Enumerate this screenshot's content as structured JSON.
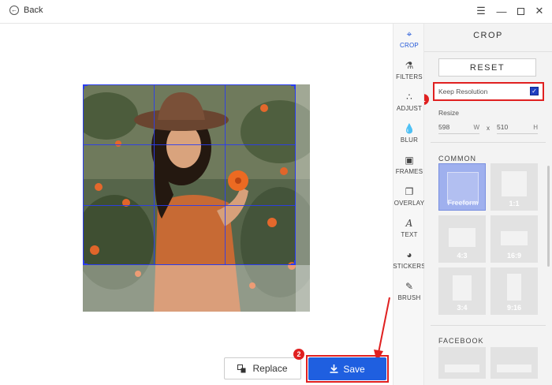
{
  "titlebar": {
    "back_label": "Back",
    "icons": [
      "back-arrow-icon",
      "hamburger-menu-icon",
      "minimize-icon",
      "maximize-icon",
      "close-icon"
    ]
  },
  "tools": [
    {
      "label": "CROP",
      "icon": "crop-icon",
      "active": true
    },
    {
      "label": "FILTERS",
      "icon": "flask-icon",
      "active": false
    },
    {
      "label": "ADJUST",
      "icon": "adjust-icon",
      "active": false
    },
    {
      "label": "BLUR",
      "icon": "droplet-icon",
      "active": false
    },
    {
      "label": "FRAMES",
      "icon": "frame-icon",
      "active": false
    },
    {
      "label": "OVERLAY",
      "icon": "overlay-icon",
      "active": false
    },
    {
      "label": "TEXT",
      "icon": "text-icon",
      "active": false
    },
    {
      "label": "STICKERS",
      "icon": "sticker-icon",
      "active": false
    },
    {
      "label": "BRUSH",
      "icon": "brush-icon",
      "active": false
    }
  ],
  "panel": {
    "title": "CROP",
    "reset_label": "RESET",
    "keep_resolution_label": "Keep Resolution",
    "keep_resolution_checked": true,
    "resize_label": "Resize",
    "width_value": "598",
    "width_unit": "W",
    "times": "x",
    "height_value": "510",
    "height_unit": "H",
    "common_label": "COMMON",
    "presets": [
      "Freeform",
      "1:1",
      "4:3",
      "16:9",
      "3:4",
      "9:16"
    ],
    "selected_preset": "Freeform",
    "facebook_label": "FACEBOOK"
  },
  "buttons": {
    "replace_label": "Replace",
    "save_label": "Save"
  },
  "callouts": {
    "step1": "1",
    "step2": "2"
  },
  "colors": {
    "accent_blue": "#1f5fe0",
    "highlight_red": "#e02020",
    "crop_grid": "#2a3df0"
  }
}
